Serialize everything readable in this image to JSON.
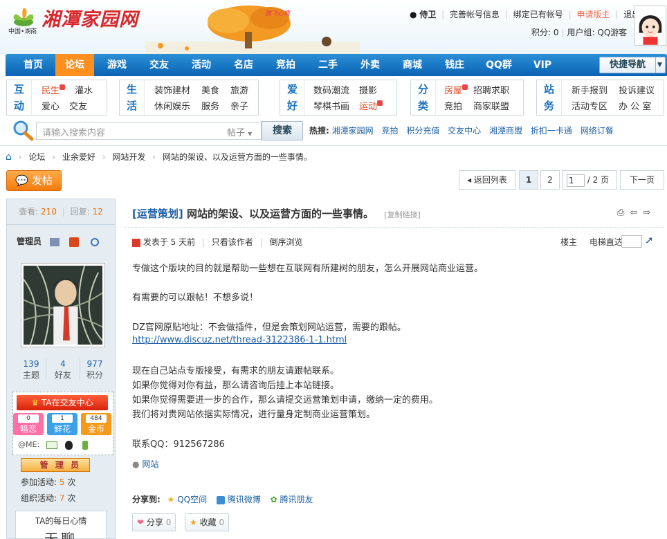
{
  "header": {
    "logo_sub": "中国•湖南",
    "logo_text": "湘潭家园网",
    "art_caption": "放飞心情",
    "user": {
      "name": "侍卫",
      "links": [
        "完善帐号信息",
        "绑定已有帐号",
        "申请版主",
        "退出"
      ],
      "score_label": "积分: 0",
      "group_label": "用户组: QQ游客"
    }
  },
  "nav": {
    "items": [
      "首页",
      "论坛",
      "游戏",
      "交友",
      "活动",
      "名店",
      "竞拍",
      "二手",
      "外卖",
      "商城",
      "钱庄",
      "QQ群",
      "VIP"
    ],
    "active": "论坛",
    "quick_nav": "快捷导航"
  },
  "categories": [
    {
      "head": [
        "互",
        "动"
      ],
      "links": [
        [
          "民生",
          "灌水"
        ],
        [
          "爱心",
          "交友"
        ]
      ],
      "hot": [
        "民生"
      ]
    },
    {
      "head": [
        "生",
        "活"
      ],
      "links": [
        [
          "装饰建材",
          "美食",
          "旅游"
        ],
        [
          "休闲娱乐",
          "服务",
          "亲子"
        ]
      ],
      "hot": []
    },
    {
      "head": [
        "爱",
        "好"
      ],
      "links": [
        [
          "数码潮流",
          "摄影"
        ],
        [
          "琴棋书画",
          "运动"
        ]
      ],
      "hot": [
        "运动"
      ]
    },
    {
      "head": [
        "分",
        "类"
      ],
      "links": [
        [
          "房屋",
          "招聘求职"
        ],
        [
          "竞拍",
          "商家联盟"
        ]
      ],
      "hot": [
        "房屋"
      ]
    },
    {
      "head": [
        "站",
        "务"
      ],
      "links": [
        [
          "新手报到",
          "投诉建议"
        ],
        [
          "活动专区",
          "办 公 室"
        ]
      ],
      "hot": []
    }
  ],
  "search": {
    "placeholder": "请输入搜索内容",
    "type": "帖子",
    "button": "搜索",
    "hot_label": "热搜:",
    "hot_words": [
      "湘潭家园网",
      "竞拍",
      "积分充值",
      "交友中心",
      "湘潭商盟",
      "折扣一卡通",
      "网络订餐"
    ]
  },
  "breadcrumb": [
    "论坛",
    "业余爱好",
    "网站开发",
    "网站的架设、以及运营方面的一些事情。"
  ],
  "toolbar": {
    "post_button": "发帖",
    "back_list": "返回列表",
    "pages": [
      "1",
      "2"
    ],
    "page_input": "1",
    "page_total": "/ 2 页",
    "next": "下一页"
  },
  "author": {
    "views_label": "查看:",
    "views": "210",
    "replies_label": "回复:",
    "replies": "12",
    "role": "管理员",
    "stats": [
      {
        "value": "139",
        "label": "主题"
      },
      {
        "value": "4",
        "label": "好友"
      },
      {
        "value": "977",
        "label": "积分"
      }
    ],
    "ta_center": "TA在交友中心",
    "gifts": [
      {
        "value": "0",
        "label": "暗恋",
        "color": "#ff6fa8"
      },
      {
        "value": "1",
        "label": "鲜花",
        "color": "#3aa0e8"
      },
      {
        "value": "484",
        "label": "金币",
        "color": "#f59a1a"
      }
    ],
    "me_label": "@ME:",
    "badge": "管 理 员",
    "activity_join_label": "参加活动:",
    "activity_join": "5",
    "activity_org_label": "组织活动:",
    "activity_org": "7",
    "unit": "次",
    "mood_title": "TA的每日心情",
    "mood_text": "无聊"
  },
  "post": {
    "title_tag": "[运营策划]",
    "title": "网站的架设、以及运营方面的一些事情。",
    "copy_link": "[复制链接]",
    "posted": "发表于 5 天前",
    "only_author": "只看该作者",
    "reverse": "倒序浏览",
    "floor": "楼主",
    "jump_label": "电梯直达",
    "lines": [
      "专做这个版块的目的就是帮助一些想在互联网有所建树的朋友，怎么开展网站商业运营。",
      "有需要的可以跟帖！不想多说！",
      "DZ官网原贴地址：不会做插件，但是会策划网站运营，需要的跟帖。",
      "http://www.discuz.net/thread-3122386-1-1.html",
      "现在自己站点专版接受，有需求的朋友请跟帖联系。",
      "如果你觉得对你有益，那么请咨询后挂上本站链接。",
      "如果你觉得需要进一步的合作，那么请提交运营策划申请，缴纳一定的费用。",
      "我们将对贵网站依据实际情况，进行量身定制商业运营策划。",
      "联系QQ：912567286"
    ],
    "tag": "网站",
    "share_label": "分享到:",
    "share_targets": [
      "QQ空间",
      "腾讯微博",
      "腾讯朋友"
    ],
    "share_btn": "分享",
    "share_count": "0",
    "fav_btn": "收藏",
    "fav_count": "0"
  }
}
